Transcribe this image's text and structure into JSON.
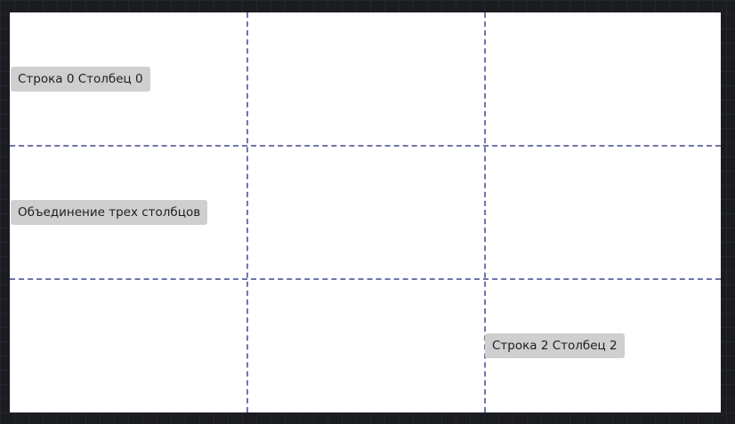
{
  "grid": {
    "rows": 3,
    "columns": 3,
    "cells": [
      {
        "label": "Строка 0 Столбец 0"
      },
      {
        "label": "Объединение трех столбцов"
      },
      {
        "label": "Строка 2 Столбец 2"
      }
    ]
  },
  "colors": {
    "background": "#1b1c1f",
    "canvas": "#ffffff",
    "grid_line": "#6f74ad",
    "label_bg": "#cfcfcf"
  }
}
